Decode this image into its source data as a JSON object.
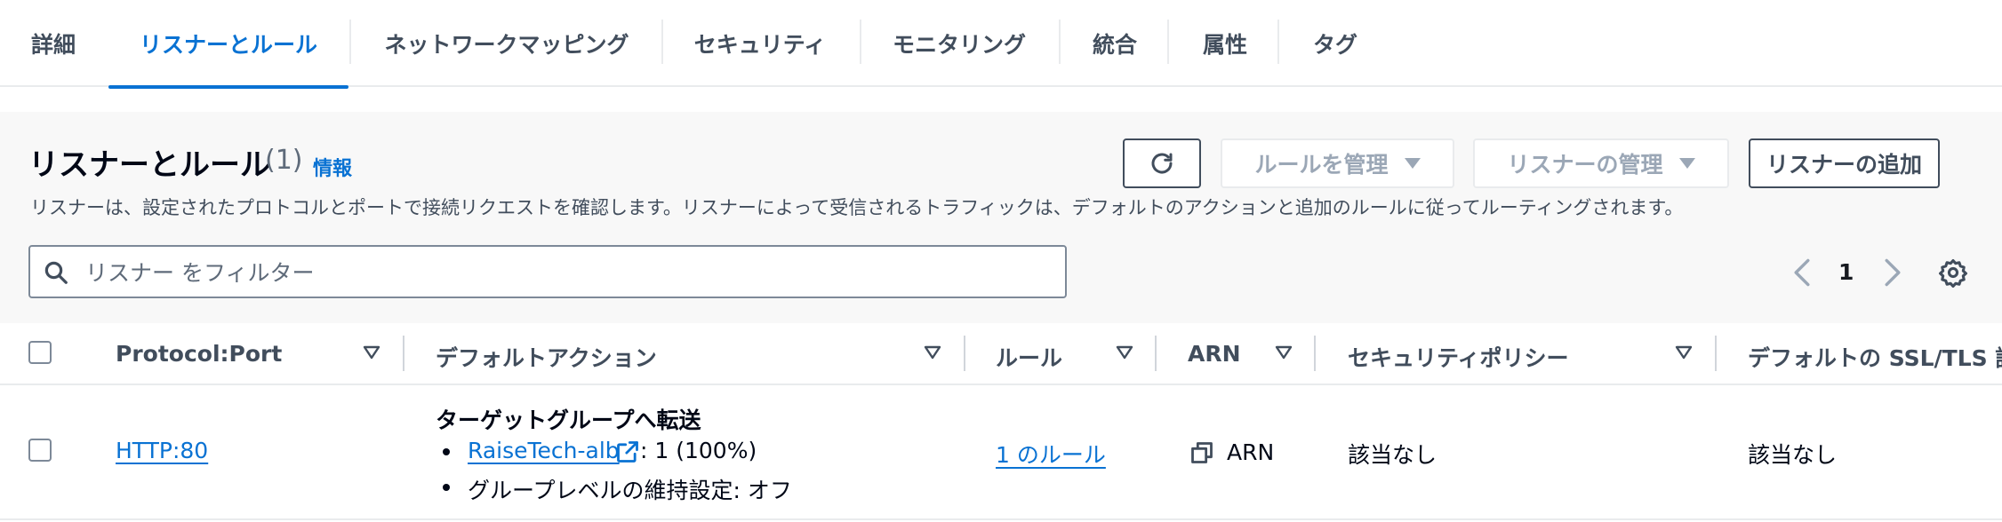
{
  "tabs": [
    {
      "label": "詳細",
      "active": false
    },
    {
      "label": "リスナーとルール",
      "active": true
    },
    {
      "label": "ネットワークマッピング",
      "active": false
    },
    {
      "label": "セキュリティ",
      "active": false
    },
    {
      "label": "モニタリング",
      "active": false
    },
    {
      "label": "統合",
      "active": false
    },
    {
      "label": "属性",
      "active": false
    },
    {
      "label": "タグ",
      "active": false
    }
  ],
  "header": {
    "title": "リスナーとルール",
    "count": "(1)",
    "info": "情報",
    "description": "リスナーは、設定されたプロトコルとポートで接続リクエストを確認します。リスナーによって受信されるトラフィックは、デフォルトのアクションと追加のルールに従ってルーティングされます。"
  },
  "actions": {
    "refresh_icon": "refresh-icon",
    "manage_rules": "ルールを管理",
    "manage_listener": "リスナーの管理",
    "add_listener": "リスナーの追加"
  },
  "filter": {
    "placeholder": "リスナー をフィルター"
  },
  "pagination": {
    "current_page": "1"
  },
  "table": {
    "columns": [
      "Protocol:Port",
      "デフォルトアクション",
      "ルール",
      "ARN",
      "セキュリティポリシー",
      "デフォルトの SSL/TLS 証"
    ],
    "rows": [
      {
        "protocol_port": "HTTP:80",
        "action_title": "ターゲットグループへ転送",
        "target_group": "RaiseTech-alb",
        "target_weight": ": 1 (100%)",
        "stickiness": "グループレベルの維持設定: オフ",
        "rules": "1 のルール",
        "arn": "ARN",
        "security_policy": "該当なし",
        "ssl_cert": "該当なし"
      }
    ]
  },
  "colors": {
    "accent": "#0972d3",
    "text": "#16191f",
    "muted": "#414d5c",
    "disabled": "#9ba7b6",
    "panel_bg": "#f8f8f8"
  }
}
